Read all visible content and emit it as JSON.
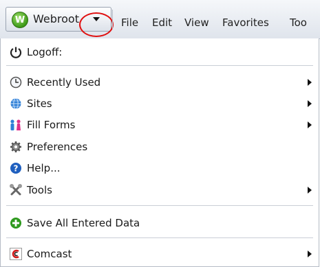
{
  "toolbar": {
    "brand": {
      "logo_letter": "W",
      "label": "Webroot"
    },
    "menus": [
      "File",
      "Edit",
      "View",
      "Favorites",
      "Too"
    ]
  },
  "menu": {
    "logoff": {
      "label": "Logoff:",
      "icon": "power-icon"
    },
    "items": [
      {
        "label": "Recently Used",
        "icon": "clock-icon",
        "submenu": true
      },
      {
        "label": "Sites",
        "icon": "globe-icon",
        "submenu": true
      },
      {
        "label": "Fill Forms",
        "icon": "people-icon",
        "submenu": true
      },
      {
        "label": "Preferences",
        "icon": "gear-icon",
        "submenu": false
      },
      {
        "label": "Help...",
        "icon": "help-icon",
        "submenu": false
      },
      {
        "label": "Tools",
        "icon": "tools-icon",
        "submenu": true
      }
    ],
    "save": {
      "label": "Save All Entered Data",
      "icon": "plus-circle-icon"
    },
    "comcast": {
      "label": "Comcast",
      "icon": "comcast-icon",
      "submenu": true
    }
  },
  "colors": {
    "accent_green": "#3d9a18",
    "annotation_red": "#e01010",
    "globe_blue": "#2f7fd6",
    "help_blue": "#1f5fbf",
    "comcast_red": "#d21c1c"
  }
}
